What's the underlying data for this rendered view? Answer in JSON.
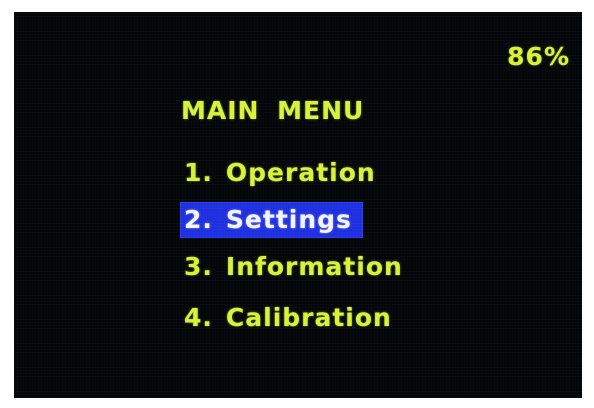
{
  "status": {
    "battery": "86%"
  },
  "menu": {
    "title": "MAIN MENU",
    "items": [
      {
        "number": "1.",
        "label": "Operation",
        "selected": false
      },
      {
        "number": "2.",
        "label": "Settings",
        "selected": true
      },
      {
        "number": "3.",
        "label": "Information",
        "selected": false
      },
      {
        "number": "4.",
        "label": "Calibration",
        "selected": false
      }
    ]
  },
  "colors": {
    "background": "#030608",
    "text": "#d8f23a",
    "highlight": "#1e2fe0",
    "highlight_text": "#f2f4ff"
  }
}
